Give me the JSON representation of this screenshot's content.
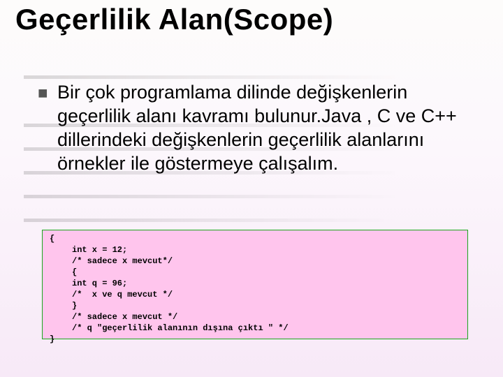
{
  "title": "Geçerlilik Alan(Scope)",
  "bullet": {
    "mark": "■",
    "text": "Bir çok programlama dilinde değişkenlerin geçerlilik alanı kavramı bulunur.Java , C ve C++ dillerindeki değişkenlerin geçerlilik alanlarını örnekler ile göstermeye çalışalım."
  },
  "code": {
    "l0": "{",
    "l1": "int x = 12;",
    "l2": "/* sadece x mevcut*/",
    "l3": "{",
    "l4": "int q = 96;",
    "l5": "/*  x ve q mevcut */",
    "l6": "}",
    "l7": "/* sadece x mevcut */",
    "l8": "/* q \"geçerlilik alanının dışına çıktı \" */",
    "l9": "}"
  }
}
